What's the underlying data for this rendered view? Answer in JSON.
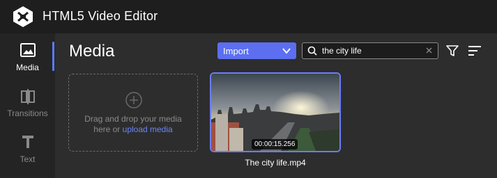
{
  "app": {
    "title": "HTML5 Video Editor",
    "logo_icon": "logo-icon"
  },
  "sidebar": {
    "active_color": "#5b7cfa",
    "items": [
      {
        "label": "Media",
        "icon": "image-icon",
        "active": true
      },
      {
        "label": "Transitions",
        "icon": "transitions-icon",
        "active": false
      },
      {
        "label": "Text",
        "icon": "text-icon",
        "active": false
      }
    ]
  },
  "main": {
    "title": "Media",
    "import": {
      "label": "Import",
      "color": "#5b6ff0"
    },
    "search": {
      "value": "the city life",
      "placeholder": ""
    },
    "dropzone": {
      "line1": "Drag and drop your media",
      "line2_prefix": "here or ",
      "line2_link": "upload media"
    },
    "media_items": [
      {
        "filename": "The city life.mp4",
        "duration": "00:00:15.256",
        "selected": true
      }
    ]
  }
}
